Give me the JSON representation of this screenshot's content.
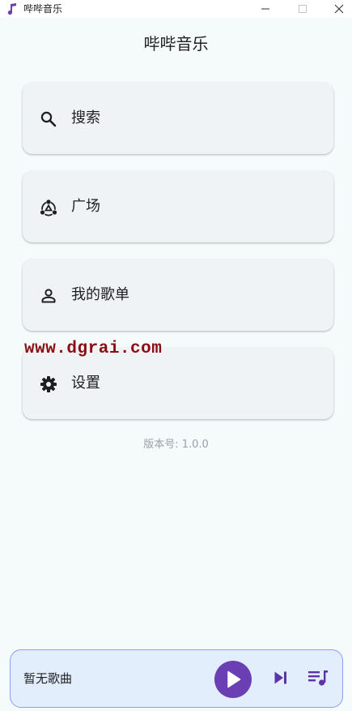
{
  "window": {
    "title": "哔哔音乐",
    "controls": [
      "minimize",
      "maximize",
      "close"
    ]
  },
  "header": {
    "title": "哔哔音乐"
  },
  "menu": {
    "items": [
      {
        "label": "搜索",
        "icon": "search-icon"
      },
      {
        "label": "广场",
        "icon": "square-icon"
      },
      {
        "label": "我的歌单",
        "icon": "person-icon"
      },
      {
        "label": "设置",
        "icon": "gear-icon"
      }
    ]
  },
  "watermark": "www.dgrai.com",
  "version": "版本号: 1.0.0",
  "player": {
    "now_playing": "暂无歌曲",
    "controls": [
      "play-icon",
      "skip-next-icon",
      "queue-music-icon"
    ]
  },
  "colors": {
    "background": "#f5fafb",
    "card": "#eff3f5",
    "accent": "#6a3fb3",
    "player_bar": "#e2eefb",
    "player_border": "#8d9df0",
    "watermark": "#8b0d14",
    "version_text": "#9aa0a6"
  }
}
